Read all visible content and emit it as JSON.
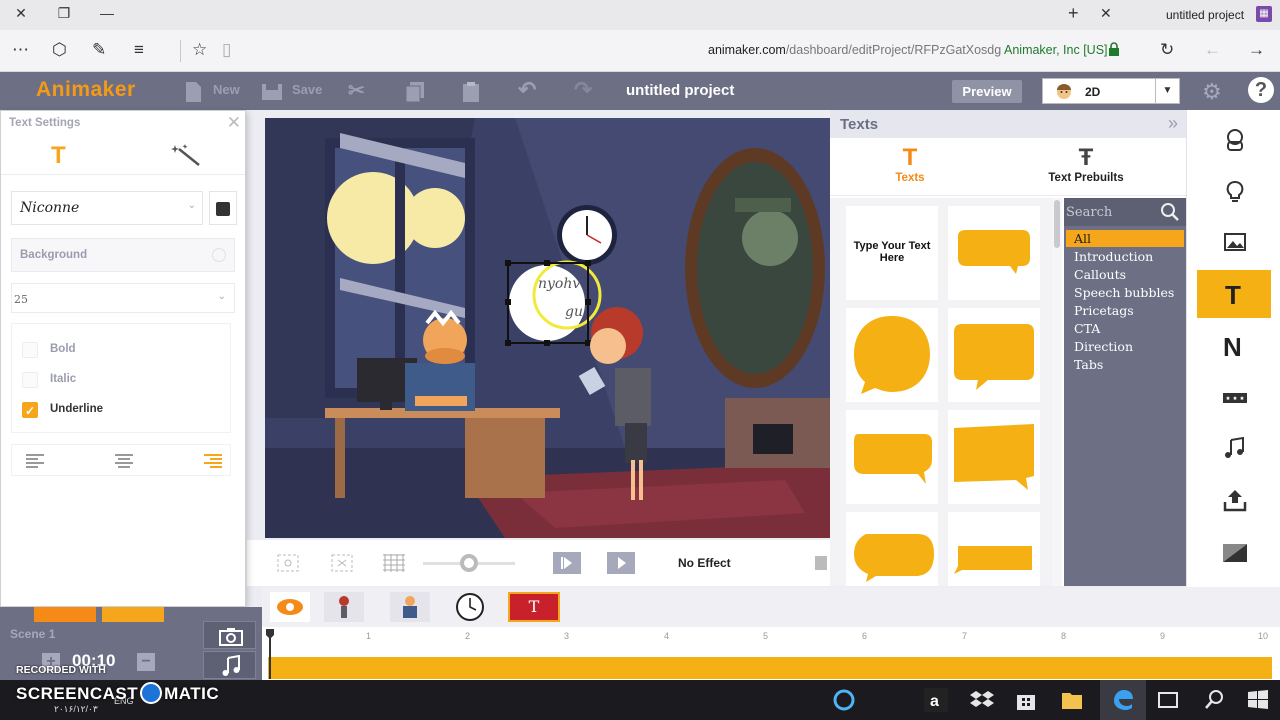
{
  "browser": {
    "tab_title": "untitled project",
    "url_host": "animaker.com",
    "url_path": "/dashboard/editProject/RFPzGatXosdg",
    "secure_label": "Animaker, Inc [US]"
  },
  "header": {
    "logo": "Animaker",
    "new_label": "New",
    "save_label": "Save",
    "project_title": "untitled project",
    "preview_label": "Preview",
    "mode_value": "2D"
  },
  "text_settings": {
    "title": "Text Settings",
    "font": "Niconne",
    "background_label": "Background",
    "size": "25",
    "bold_label": "Bold",
    "italic_label": "Italic",
    "underline_label": "Underline",
    "underline_checked": true
  },
  "stage": {
    "selected_text_line1": "nyohv",
    "selected_text_line2": "gu"
  },
  "stage_toolbar": {
    "effect_label": "No Effect"
  },
  "texts_panel": {
    "title": "Texts",
    "tab_texts": "Texts",
    "tab_prebuilts": "Text Prebuilts",
    "type_your_text": "Type Your Text Here",
    "search_placeholder": "Search",
    "categories": [
      "All",
      "Introduction",
      "Callouts",
      "Speech bubbles",
      "Pricetags",
      "CTA",
      "Direction",
      "Tabs"
    ]
  },
  "scene": {
    "label": "Scene 1",
    "duration": "00:10"
  },
  "timeline": {
    "ticks": [
      "1",
      "2",
      "3",
      "4",
      "5",
      "6",
      "7",
      "8",
      "9",
      "10"
    ],
    "selected_thumb": "T"
  },
  "watermark": {
    "line1": "RECORDED WITH",
    "line2a": "SCREENCAST",
    "line2b": "MATIC"
  },
  "taskbar": {
    "lang": "ENG",
    "date": "۲۰۱۶/۱۲/۰۳"
  },
  "colors": {
    "accent": "#f5a61b",
    "header": "#6d6f85",
    "bubble": "#f5b013"
  }
}
